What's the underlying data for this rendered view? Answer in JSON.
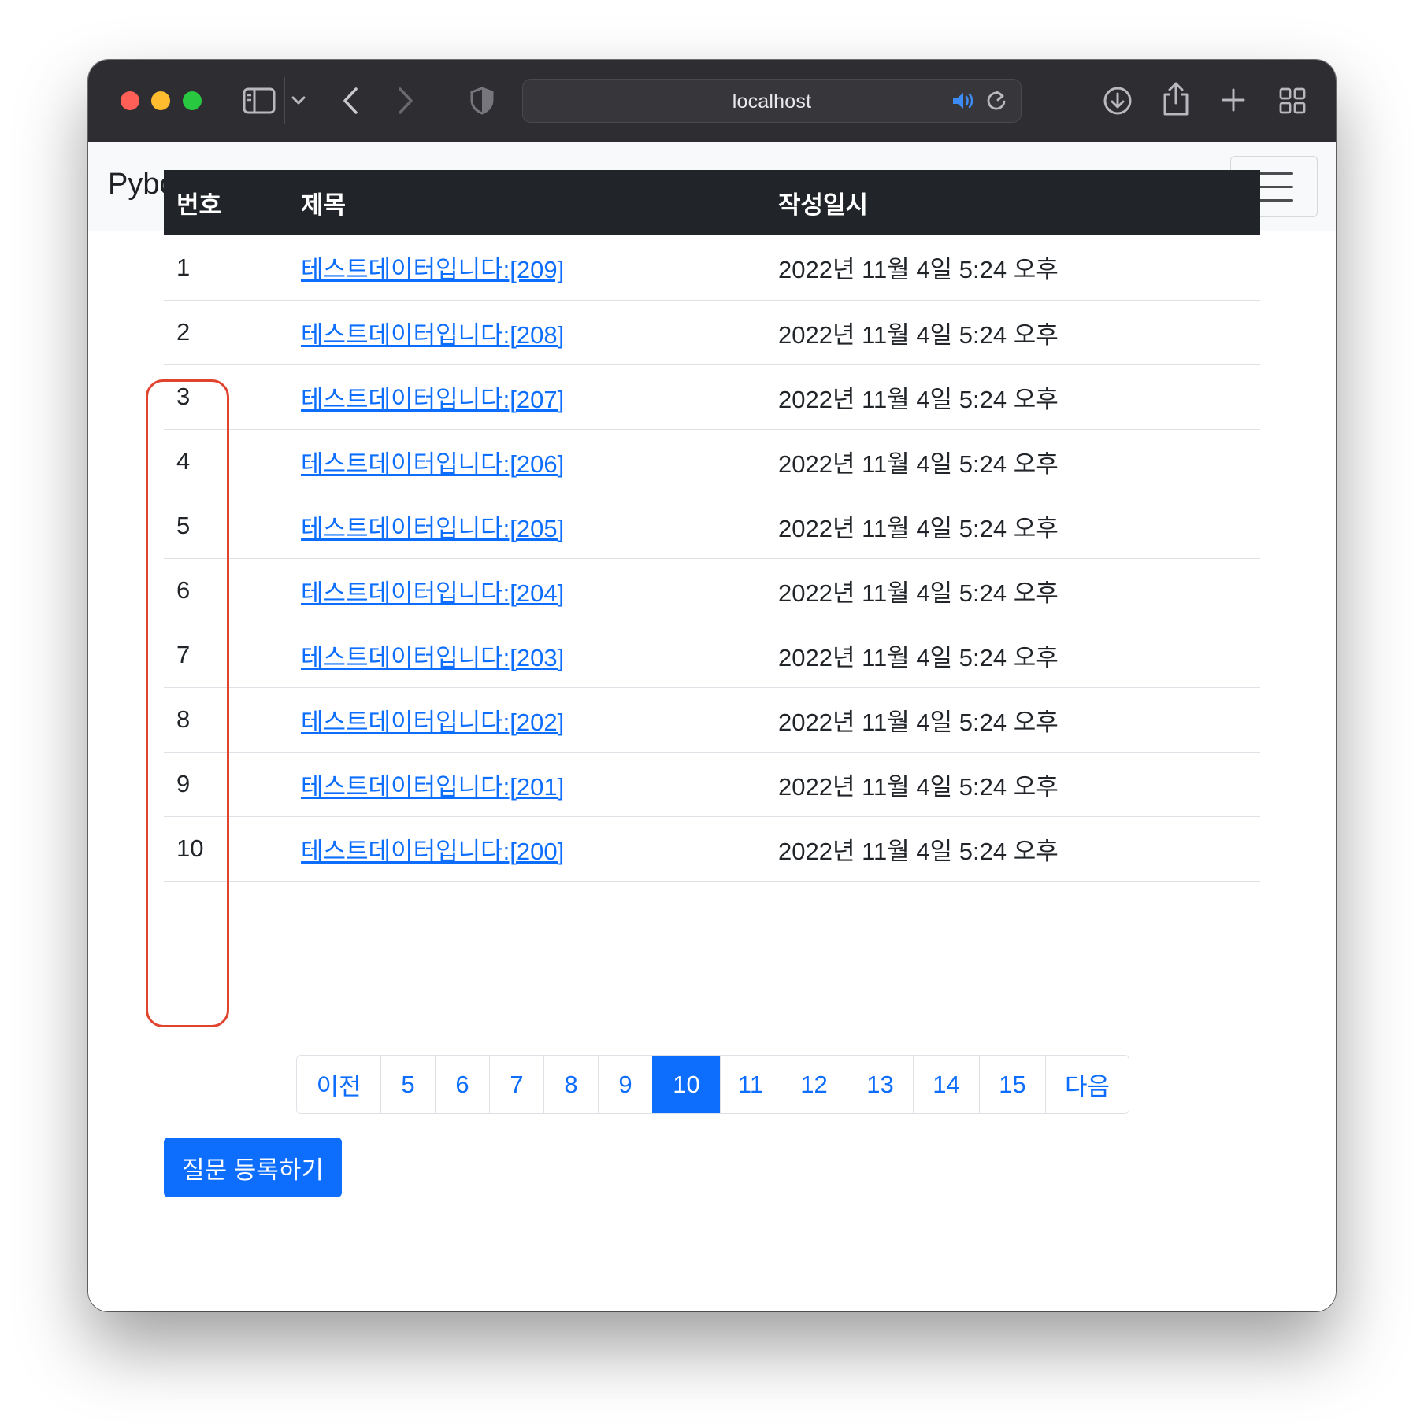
{
  "browser": {
    "url": "localhost",
    "icons": [
      "sidebar-icon",
      "chevron-down-icon",
      "back-icon",
      "forward-icon",
      "shield-icon",
      "speaker-icon",
      "reload-icon",
      "download-icon",
      "share-icon",
      "new-tab-icon",
      "tab-overview-icon"
    ]
  },
  "navbar": {
    "brand": "Pybo",
    "toggler_icon": "hamburger-icon"
  },
  "table": {
    "headers": [
      "번호",
      "제목",
      "작성일시"
    ],
    "rows": [
      {
        "num": "1",
        "subject": "테스트데이터입니다:[209]",
        "date": "2022년 11월 4일 5:24 오후"
      },
      {
        "num": "2",
        "subject": "테스트데이터입니다:[208]",
        "date": "2022년 11월 4일 5:24 오후"
      },
      {
        "num": "3",
        "subject": "테스트데이터입니다:[207]",
        "date": "2022년 11월 4일 5:24 오후"
      },
      {
        "num": "4",
        "subject": "테스트데이터입니다:[206]",
        "date": "2022년 11월 4일 5:24 오후"
      },
      {
        "num": "5",
        "subject": "테스트데이터입니다:[205]",
        "date": "2022년 11월 4일 5:24 오후"
      },
      {
        "num": "6",
        "subject": "테스트데이터입니다:[204]",
        "date": "2022년 11월 4일 5:24 오후"
      },
      {
        "num": "7",
        "subject": "테스트데이터입니다:[203]",
        "date": "2022년 11월 4일 5:24 오후"
      },
      {
        "num": "8",
        "subject": "테스트데이터입니다:[202]",
        "date": "2022년 11월 4일 5:24 오후"
      },
      {
        "num": "9",
        "subject": "테스트데이터입니다:[201]",
        "date": "2022년 11월 4일 5:24 오후"
      },
      {
        "num": "10",
        "subject": "테스트데이터입니다:[200]",
        "date": "2022년 11월 4일 5:24 오후"
      }
    ]
  },
  "pagination": {
    "items": [
      {
        "label": "이전",
        "active": false
      },
      {
        "label": "5",
        "active": false
      },
      {
        "label": "6",
        "active": false
      },
      {
        "label": "7",
        "active": false
      },
      {
        "label": "8",
        "active": false
      },
      {
        "label": "9",
        "active": false
      },
      {
        "label": "10",
        "active": true
      },
      {
        "label": "11",
        "active": false
      },
      {
        "label": "12",
        "active": false
      },
      {
        "label": "13",
        "active": false
      },
      {
        "label": "14",
        "active": false
      },
      {
        "label": "15",
        "active": false
      },
      {
        "label": "다음",
        "active": false
      }
    ]
  },
  "actions": {
    "register_label": "질문 등록하기"
  },
  "colors": {
    "primary": "#0d6efd",
    "table_header_bg": "#212529",
    "highlight_outline": "#e0442f"
  }
}
